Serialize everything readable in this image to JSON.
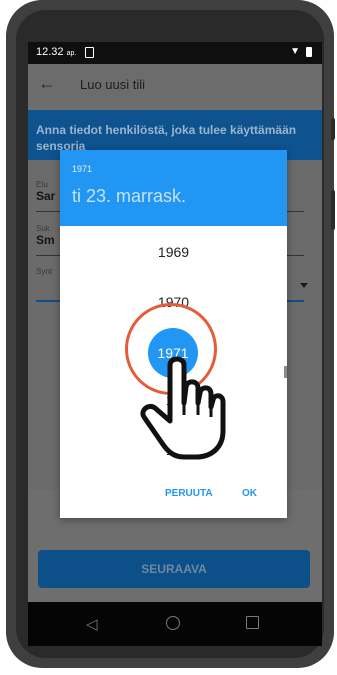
{
  "status_bar": {
    "time": "12.32",
    "ampm": "ap."
  },
  "app_bar": {
    "back_glyph": "←",
    "title": "Luo uusi tili"
  },
  "banner": {
    "text": "Anna tiedot henkilöstä, joka tulee käyttämään sensoria"
  },
  "form": {
    "first_name": {
      "label": "Etu",
      "value": "Sar"
    },
    "last_name": {
      "label": "Suk",
      "value": "Sm"
    },
    "birth": {
      "label": "Synt"
    }
  },
  "next_button": "SEURAAVA",
  "dialog": {
    "header_year": "1971",
    "header_date": "ti 23. marrask.",
    "years": [
      "1969",
      "1970",
      "1971",
      "19",
      "19"
    ],
    "selected_year": "1971",
    "cancel": "PERUUTA",
    "ok": "OK"
  },
  "nav": {
    "back": "◁"
  },
  "colors": {
    "accent": "#2196f3",
    "ring": "#e45c3a",
    "banner": "#0e5390"
  },
  "icons": [
    "back-arrow-icon",
    "wifi-icon",
    "battery-icon",
    "sim-icon",
    "nav-back-icon",
    "nav-home-icon",
    "nav-recent-icon",
    "hand-pointer-icon"
  ]
}
